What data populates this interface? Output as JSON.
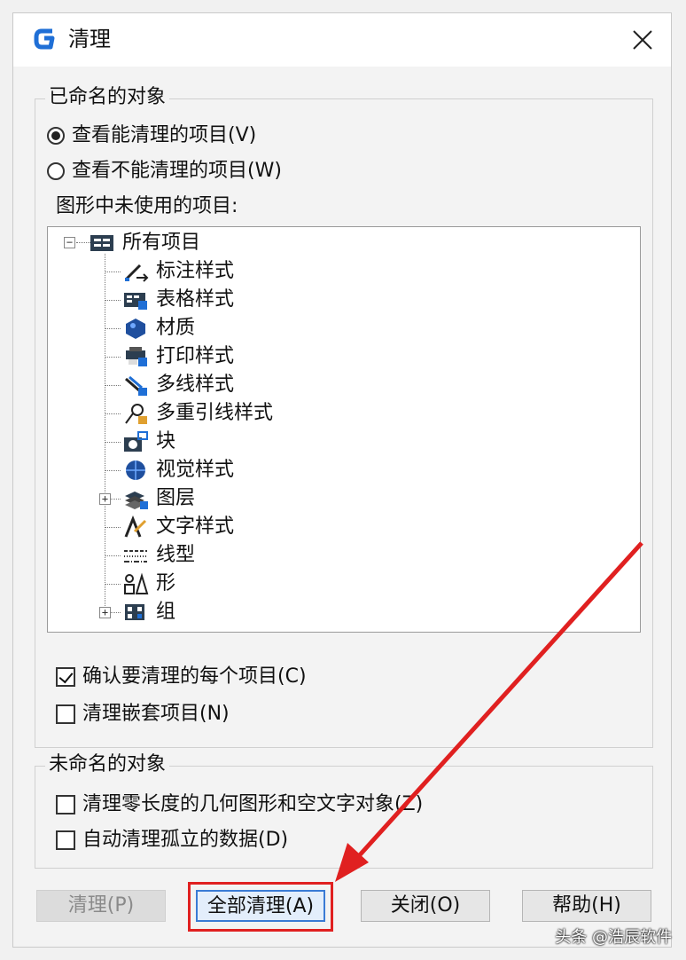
{
  "window": {
    "title": "清理"
  },
  "named_objects": {
    "legend": "已命名的对象",
    "view_purgeable": "查看能清理的项目(V)",
    "view_unpurgeable": "查看不能清理的项目(W)",
    "tree_label": "图形中未使用的项目:",
    "tree": {
      "root": "所有项目",
      "items": [
        {
          "label": "标注样式",
          "icon": "dimension-style-icon"
        },
        {
          "label": "表格样式",
          "icon": "table-style-icon"
        },
        {
          "label": "材质",
          "icon": "material-icon"
        },
        {
          "label": "打印样式",
          "icon": "plot-style-icon"
        },
        {
          "label": "多线样式",
          "icon": "multiline-style-icon"
        },
        {
          "label": "多重引线样式",
          "icon": "multileader-style-icon"
        },
        {
          "label": "块",
          "icon": "block-icon"
        },
        {
          "label": "视觉样式",
          "icon": "visual-style-icon"
        },
        {
          "label": "图层",
          "icon": "layer-icon"
        },
        {
          "label": "文字样式",
          "icon": "text-style-icon"
        },
        {
          "label": "线型",
          "icon": "linetype-icon"
        },
        {
          "label": "形",
          "icon": "shape-icon"
        },
        {
          "label": "组",
          "icon": "group-icon"
        }
      ]
    },
    "confirm_each": "确认要清理的每个项目(C)",
    "confirm_each_checked": true,
    "purge_nested": "清理嵌套项目(N)",
    "purge_nested_checked": false
  },
  "unnamed_objects": {
    "legend": "未命名的对象",
    "zero_length": "清理零长度的几何图形和空文字对象(Z)",
    "orphaned_data": "自动清理孤立的数据(D)"
  },
  "buttons": {
    "purge": "清理(P)",
    "purge_all": "全部清理(A)",
    "close": "关闭(O)",
    "help": "帮助(H)"
  },
  "watermark": "头条 @浩辰软件",
  "colors": {
    "annotation_red": "#e02020",
    "app_blue": "#1f6fd6"
  }
}
